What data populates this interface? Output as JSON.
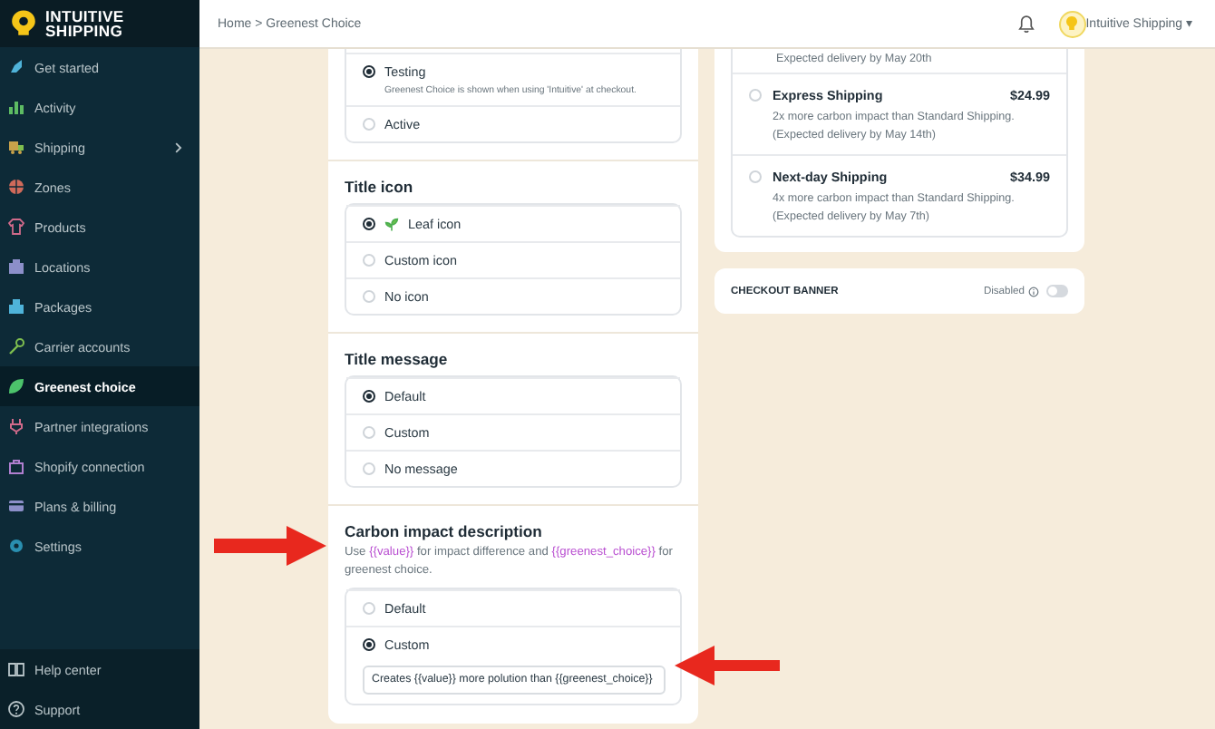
{
  "logo": {
    "lines": [
      "INTUITIVE",
      "SHIPPING"
    ]
  },
  "sidebar": {
    "items": [
      {
        "label": "Get started",
        "selected": false,
        "has_submenu": false
      },
      {
        "label": "Activity",
        "selected": false,
        "has_submenu": false
      },
      {
        "label": "Shipping",
        "selected": false,
        "has_submenu": true
      },
      {
        "label": "Zones",
        "selected": false,
        "has_submenu": false
      },
      {
        "label": "Products",
        "selected": false,
        "has_submenu": false
      },
      {
        "label": "Locations",
        "selected": false,
        "has_submenu": false
      },
      {
        "label": "Packages",
        "selected": false,
        "has_submenu": false
      },
      {
        "label": "Carrier accounts",
        "selected": false,
        "has_submenu": false
      },
      {
        "label": "Greenest choice",
        "selected": true,
        "has_submenu": false
      },
      {
        "label": "Partner integrations",
        "selected": false,
        "has_submenu": false
      },
      {
        "label": "Shopify connection",
        "selected": false,
        "has_submenu": false
      },
      {
        "label": "Plans & billing",
        "selected": false,
        "has_submenu": false
      },
      {
        "label": "Settings",
        "selected": false,
        "has_submenu": false
      }
    ],
    "footer_items": [
      {
        "label": "Help center"
      },
      {
        "label": "Support"
      }
    ]
  },
  "header": {
    "breadcrumb": [
      "Home",
      "Greenest Choice"
    ],
    "breadcrumb_separator": ">",
    "account": {
      "name": "Intuitive Shipping",
      "caret": "▾"
    }
  },
  "settings": {
    "sections": [
      {
        "options": [
          {
            "label": "Testing",
            "selected": true,
            "description": "Greenest Choice is shown when using 'Intuitive' at checkout."
          },
          {
            "label": "Active",
            "selected": false
          }
        ]
      },
      {
        "heading": "Title icon",
        "options": [
          {
            "label": "Leaf icon",
            "selected": true,
            "show_icon": true
          },
          {
            "label": "Custom icon",
            "selected": false
          },
          {
            "label": "No icon",
            "selected": false
          }
        ]
      },
      {
        "heading": "Title message",
        "options": [
          {
            "label": "Default",
            "selected": true
          },
          {
            "label": "Custom",
            "selected": false
          },
          {
            "label": "No message",
            "selected": false
          }
        ]
      },
      {
        "heading": "Carbon impact description",
        "description": [
          {
            "text": "Use ",
            "kind": "plain"
          },
          {
            "text": "{{value}}",
            "kind": "variable"
          },
          {
            "text": " for impact difference and ",
            "kind": "plain"
          },
          {
            "text": "{{greenest_choice}}",
            "kind": "variable"
          },
          {
            "text": " for greenest choice.",
            "kind": "plain"
          }
        ],
        "options": [
          {
            "label": "Default",
            "selected": false
          },
          {
            "label": "Custom",
            "selected": true,
            "input_value": "Creates {{value}} more polution than {{greenest_choice}}"
          }
        ]
      }
    ]
  },
  "preview": {
    "cut_text": "Expected delivery by May 20th",
    "options": [
      {
        "title": "Express Shipping",
        "price": "$24.99",
        "selected": false,
        "description_lines": [
          "2x more carbon impact than Standard Shipping.",
          "(Expected delivery by May 14th)"
        ]
      },
      {
        "title": "Next-day Shipping",
        "price": "$34.99",
        "selected": false,
        "description_lines": [
          "4x more carbon impact than Standard Shipping.",
          "(Expected delivery by May 7th)"
        ]
      }
    ]
  },
  "checkout_banner": {
    "title": "CHECKOUT BANNER",
    "status": "Disabled",
    "on": false
  }
}
